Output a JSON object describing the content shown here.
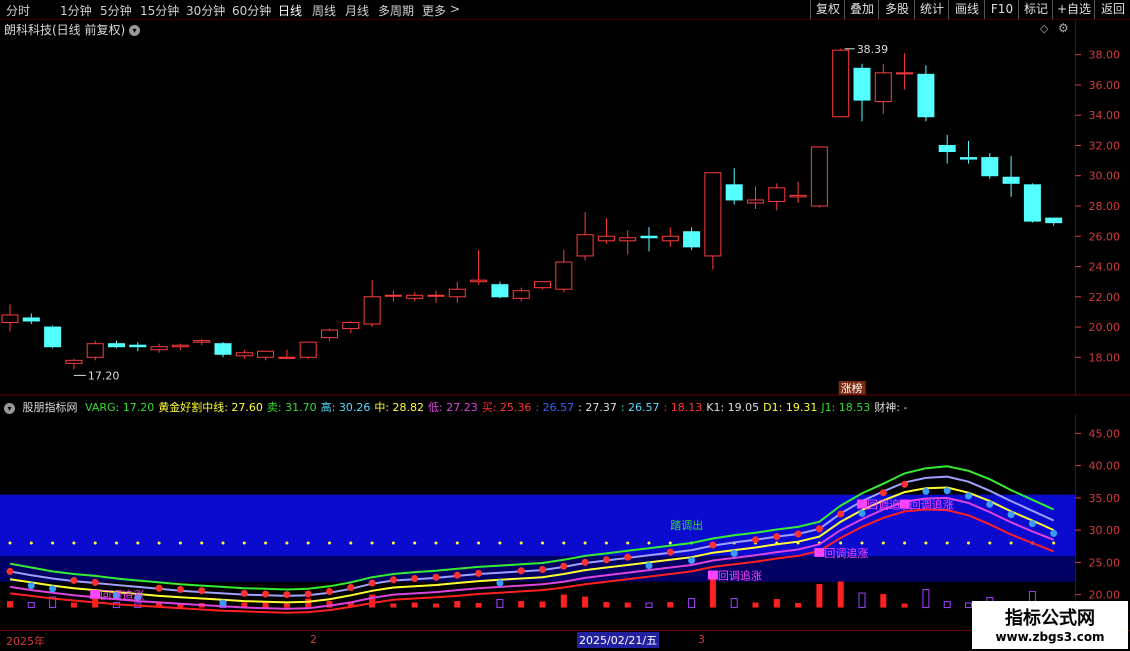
{
  "toolbar": {
    "periods": [
      "分时",
      "1分钟",
      "5分钟",
      "15分钟",
      "30分钟",
      "60分钟",
      "日线",
      "周线",
      "月线",
      "多周期",
      "更多"
    ],
    "more_arrow": ">",
    "right_buttons": [
      "复权",
      "叠加",
      "多股",
      "统计",
      "画线",
      "F10",
      "标记",
      "+自选",
      "返回"
    ]
  },
  "main_chart": {
    "title": "朗科科技(日线 前复权)",
    "high_label": "38.39",
    "low_label": "17.20",
    "badge": "涨榜",
    "y_ticks": [
      "38.00",
      "36.00",
      "34.00",
      "32.00",
      "30.00",
      "28.00",
      "26.00",
      "24.00",
      "22.00",
      "20.00",
      "18.00"
    ]
  },
  "indicator": {
    "name": "股朋指标网",
    "values": [
      {
        "text": "VARG: 17.20",
        "color": "#33dd33"
      },
      {
        "text": "黄金好割中线: 27.60",
        "color": "#ffff33"
      },
      {
        "text": "卖: 31.70",
        "color": "#33dd33"
      },
      {
        "text": "高: 30.26",
        "color": "#55ddff"
      },
      {
        "text": "中: 28.82",
        "color": "#ffff33"
      },
      {
        "text": "低: 27.23",
        "color": "#dd44dd"
      },
      {
        "text": "买: 25.36",
        "color": "#ff3333"
      },
      {
        "text": ": 26.57",
        "color": "#3366ff"
      },
      {
        "text": ": 27.37",
        "color": "#dddddd"
      },
      {
        "text": ": 26.57",
        "color": "#55ddff"
      },
      {
        "text": ": 18.13",
        "color": "#ff3333"
      },
      {
        "text": "K1: 19.05",
        "color": "#dddddd"
      },
      {
        "text": "D1: 19.31",
        "color": "#ffff33"
      },
      {
        "text": "J1: 18.53",
        "color": "#33dd33"
      },
      {
        "text": "财神: -",
        "color": "#dddddd"
      }
    ],
    "y_ticks": [
      "45.00",
      "40.00",
      "35.00",
      "30.00",
      "25.00",
      "20.00"
    ],
    "signals": [
      {
        "text": "回调追涨",
        "color": "#ff44ff"
      },
      {
        "text": "回调追涨",
        "color": "#ff44ff"
      },
      {
        "text": "回调追涨",
        "color": "#ff44ff"
      },
      {
        "text": "回调追涨",
        "color": "#ff44ff"
      },
      {
        "text": "回调追涨",
        "color": "#ff44ff"
      },
      {
        "text": "踏调出",
        "color": "#33dd33"
      }
    ]
  },
  "bottom_axis": {
    "labels": [
      "2025年",
      "2",
      "2025/02/21/五",
      "3"
    ]
  },
  "watermark": {
    "line1": "指标公式网",
    "line2": "www.zbgs3.com"
  },
  "colors": {
    "up": "#ff3c3c",
    "down": "#54ffff",
    "grid": "#6a0000",
    "band": "#0b0bd0"
  },
  "chart_data": {
    "type": "candlestick",
    "title": "朗科科技(日线 前复权)",
    "ohlc": [
      [
        20.3,
        21.5,
        19.7,
        20.8
      ],
      [
        20.6,
        20.9,
        20.2,
        20.4
      ],
      [
        20.0,
        20.1,
        18.6,
        18.7
      ],
      [
        17.6,
        17.9,
        17.2,
        17.8
      ],
      [
        18.0,
        19.1,
        17.8,
        18.9
      ],
      [
        18.9,
        19.1,
        18.6,
        18.7
      ],
      [
        18.8,
        19.0,
        18.4,
        18.7
      ],
      [
        18.5,
        18.9,
        18.3,
        18.7
      ],
      [
        18.7,
        18.9,
        18.5,
        18.8
      ],
      [
        19.0,
        19.2,
        18.8,
        19.1
      ],
      [
        18.9,
        19.0,
        18.0,
        18.2
      ],
      [
        18.1,
        18.5,
        17.9,
        18.3
      ],
      [
        18.0,
        18.4,
        17.8,
        18.4
      ],
      [
        18.0,
        18.5,
        17.9,
        18.0
      ],
      [
        18.0,
        19.0,
        17.9,
        19.0
      ],
      [
        19.3,
        19.9,
        19.1,
        19.8
      ],
      [
        19.9,
        20.4,
        19.6,
        20.3
      ],
      [
        20.2,
        23.1,
        20.0,
        22.0
      ],
      [
        22.1,
        22.4,
        21.7,
        22.1
      ],
      [
        21.9,
        22.3,
        21.7,
        22.1
      ],
      [
        22.1,
        22.4,
        21.6,
        22.1
      ],
      [
        22.0,
        23.0,
        21.6,
        22.5
      ],
      [
        23.0,
        25.1,
        22.8,
        23.1
      ],
      [
        22.8,
        23.0,
        21.9,
        22.0
      ],
      [
        21.9,
        22.6,
        21.7,
        22.4
      ],
      [
        22.6,
        23.0,
        22.5,
        23.0
      ],
      [
        22.5,
        25.1,
        22.3,
        24.3
      ],
      [
        24.7,
        27.6,
        24.4,
        26.1
      ],
      [
        25.7,
        27.2,
        25.5,
        26.0
      ],
      [
        25.7,
        26.4,
        24.8,
        25.9
      ],
      [
        26.0,
        26.6,
        25.0,
        25.9
      ],
      [
        25.7,
        26.6,
        25.3,
        26.0
      ],
      [
        26.3,
        26.6,
        25.1,
        25.3
      ],
      [
        24.7,
        30.2,
        23.8,
        30.2
      ],
      [
        29.4,
        30.5,
        28.1,
        28.4
      ],
      [
        28.2,
        29.3,
        27.8,
        28.4
      ],
      [
        28.3,
        29.5,
        27.7,
        29.2
      ],
      [
        28.6,
        29.6,
        28.2,
        28.7
      ],
      [
        28.0,
        31.9,
        27.9,
        31.9
      ],
      [
        33.9,
        38.4,
        33.9,
        38.3
      ],
      [
        37.1,
        37.4,
        33.6,
        35.0
      ],
      [
        34.9,
        37.4,
        34.1,
        36.8
      ],
      [
        36.8,
        38.1,
        35.7,
        36.8
      ],
      [
        36.7,
        37.3,
        33.6,
        33.9
      ],
      [
        32.0,
        32.7,
        30.8,
        31.6
      ],
      [
        31.2,
        32.3,
        30.8,
        31.1
      ],
      [
        31.2,
        31.5,
        29.8,
        30.0
      ],
      [
        29.9,
        31.3,
        28.6,
        29.5
      ],
      [
        29.4,
        29.5,
        26.9,
        27.0
      ],
      [
        27.2,
        27.2,
        26.7,
        26.9
      ]
    ],
    "ylim": [
      16.5,
      39.5
    ],
    "indicator": {
      "type": "line",
      "ylim": [
        17,
        48
      ],
      "series": [
        {
          "name": "卖",
          "values": [
            24.8,
            24.2,
            23.6,
            23.2,
            22.9,
            22.5,
            22.2,
            21.9,
            21.6,
            21.4,
            21.2,
            21.0,
            20.9,
            20.8,
            20.9,
            21.3,
            21.9,
            22.7,
            23.2,
            23.5,
            23.7,
            24.0,
            24.3,
            24.5,
            24.7,
            24.9,
            25.4,
            26.0,
            26.4,
            26.8,
            27.2,
            27.6,
            28.0,
            28.7,
            29.2,
            29.6,
            30.1,
            30.5,
            31.3,
            33.8,
            35.7,
            37.2,
            38.8,
            39.6,
            39.9,
            39.2,
            37.9,
            36.2,
            34.7,
            33.2
          ]
        },
        {
          "name": "高",
          "values": [
            23.6,
            23.0,
            22.5,
            22.1,
            21.8,
            21.5,
            21.2,
            20.9,
            20.6,
            20.4,
            20.2,
            20.0,
            19.9,
            19.8,
            19.9,
            20.3,
            20.9,
            21.7,
            22.2,
            22.4,
            22.6,
            22.9,
            23.2,
            23.4,
            23.6,
            23.8,
            24.3,
            24.9,
            25.3,
            25.7,
            26.1,
            26.5,
            26.9,
            27.6,
            28.1,
            28.5,
            29.0,
            29.4,
            30.2,
            32.6,
            34.5,
            36.0,
            37.4,
            38.1,
            38.3,
            37.5,
            36.1,
            34.5,
            33.0,
            31.5
          ]
        },
        {
          "name": "中",
          "values": [
            22.4,
            21.9,
            21.4,
            21.0,
            20.7,
            20.4,
            20.1,
            19.8,
            19.6,
            19.4,
            19.2,
            19.0,
            18.9,
            18.8,
            18.9,
            19.3,
            19.9,
            20.6,
            21.1,
            21.3,
            21.5,
            21.8,
            22.1,
            22.3,
            22.5,
            22.7,
            23.2,
            23.8,
            24.2,
            24.6,
            25.0,
            25.4,
            25.8,
            26.5,
            26.9,
            27.3,
            27.8,
            28.2,
            29.0,
            31.3,
            33.1,
            34.6,
            35.9,
            36.5,
            36.6,
            35.8,
            34.5,
            32.9,
            31.5,
            30.0
          ]
        },
        {
          "name": "低",
          "values": [
            21.2,
            20.7,
            20.3,
            19.9,
            19.6,
            19.3,
            19.0,
            18.8,
            18.6,
            18.4,
            18.2,
            18.0,
            17.9,
            17.8,
            17.9,
            18.3,
            18.8,
            19.5,
            20.0,
            20.2,
            20.4,
            20.7,
            21.0,
            21.2,
            21.4,
            21.6,
            22.0,
            22.6,
            23.0,
            23.4,
            23.8,
            24.2,
            24.6,
            25.3,
            25.7,
            26.1,
            26.6,
            27.0,
            27.8,
            30.0,
            31.7,
            33.2,
            34.4,
            34.9,
            35.0,
            34.2,
            32.8,
            31.2,
            29.8,
            28.5
          ]
        },
        {
          "name": "买",
          "values": [
            20.2,
            19.8,
            19.4,
            19.1,
            18.8,
            18.5,
            18.3,
            18.1,
            17.9,
            17.7,
            17.5,
            17.4,
            17.3,
            17.2,
            17.3,
            17.6,
            18.1,
            18.7,
            19.2,
            19.4,
            19.6,
            19.8,
            20.1,
            20.3,
            20.5,
            20.7,
            21.1,
            21.6,
            22.0,
            22.4,
            22.8,
            23.2,
            23.6,
            24.3,
            24.7,
            25.1,
            25.6,
            26.0,
            26.8,
            28.8,
            30.5,
            31.9,
            32.9,
            33.2,
            33.1,
            32.3,
            30.9,
            29.3,
            28.0,
            26.7
          ]
        }
      ]
    }
  }
}
